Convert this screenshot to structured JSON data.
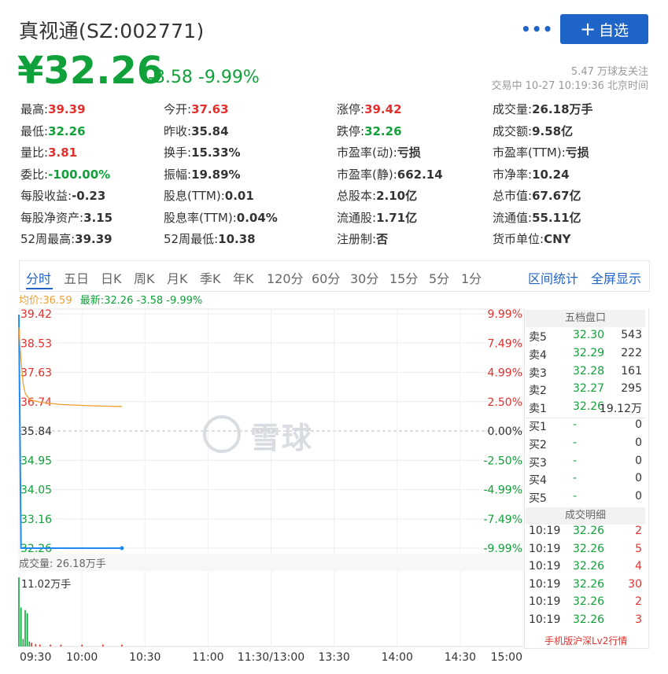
{
  "header": {
    "title": "真视通(SZ:002771)",
    "more_label": "•••",
    "add_button_label": "自选",
    "add_button_icon": "plus-icon",
    "price": "¥32.26",
    "change": "-3.58 -9.99%",
    "followers": "5.47 万球友关注",
    "trade_status": "交易中 10-27 10:19:36 北京时间"
  },
  "stats": {
    "rows": [
      [
        {
          "label": "最高:",
          "value": "39.39",
          "color": "red"
        },
        {
          "label": "今开:",
          "value": "37.63",
          "color": "red"
        },
        {
          "label": "涨停:",
          "value": "39.42",
          "color": "red"
        },
        {
          "label": "成交量:",
          "value": "26.18万手",
          "color": ""
        }
      ],
      [
        {
          "label": "最低:",
          "value": "32.26",
          "color": "green"
        },
        {
          "label": "昨收:",
          "value": "35.84",
          "color": ""
        },
        {
          "label": "跌停:",
          "value": "32.26",
          "color": "green"
        },
        {
          "label": "成交额:",
          "value": "9.58亿",
          "color": ""
        }
      ],
      [
        {
          "label": "量比:",
          "value": "3.81",
          "color": "red"
        },
        {
          "label": "换手:",
          "value": "15.33%",
          "color": ""
        },
        {
          "label": "市盈率(动):",
          "value": "亏损",
          "color": ""
        },
        {
          "label": "市盈率(TTM):",
          "value": "亏损",
          "color": ""
        }
      ],
      [
        {
          "label": "委比:",
          "value": "-100.00%",
          "color": "green"
        },
        {
          "label": "振幅:",
          "value": "19.89%",
          "color": ""
        },
        {
          "label": "市盈率(静):",
          "value": "662.14",
          "color": ""
        },
        {
          "label": "市净率:",
          "value": "10.24",
          "color": ""
        }
      ],
      [
        {
          "label": "每股收益:",
          "value": "-0.23",
          "color": ""
        },
        {
          "label": "股息(TTM):",
          "value": "0.01",
          "color": ""
        },
        {
          "label": "总股本:",
          "value": "2.10亿",
          "color": ""
        },
        {
          "label": "总市值:",
          "value": "67.67亿",
          "color": ""
        }
      ],
      [
        {
          "label": "每股净资产:",
          "value": "3.15",
          "color": ""
        },
        {
          "label": "股息率(TTM):",
          "value": "0.04%",
          "color": ""
        },
        {
          "label": "流通股:",
          "value": "1.71亿",
          "color": ""
        },
        {
          "label": "流通值:",
          "value": "55.11亿",
          "color": ""
        }
      ],
      [
        {
          "label": "52周最高:",
          "value": "39.39",
          "color": ""
        },
        {
          "label": "52周最低:",
          "value": "10.38",
          "color": ""
        },
        {
          "label": "注册制:",
          "value": "否",
          "color": ""
        },
        {
          "label": "货币单位:",
          "value": "CNY",
          "color": ""
        }
      ]
    ]
  },
  "tabs": {
    "items": [
      "分时",
      "五日",
      "日K",
      "周K",
      "月K",
      "季K",
      "年K",
      "120分",
      "60分",
      "30分",
      "15分",
      "5分",
      "1分"
    ],
    "active": "分时",
    "right": [
      "区间统计",
      "全屏显示"
    ]
  },
  "chart_info": {
    "avg_label": "均价:36.59",
    "latest_label": "最新:32.26 -3.58 -9.99%",
    "volume_label": "成交量: 26.18万手",
    "volume_max_label": "11.02万手",
    "watermark": "雪球"
  },
  "chart_data": {
    "type": "line",
    "title": "",
    "ylim": [
      32.26,
      39.42
    ],
    "y_ticks_left": [
      "39.42",
      "38.53",
      "37.63",
      "36.74",
      "35.84",
      "34.95",
      "34.05",
      "33.16",
      "32.26"
    ],
    "y_ticks_right": [
      "9.99%",
      "7.49%",
      "4.99%",
      "2.50%",
      "0.00%",
      "-2.50%",
      "-4.99%",
      "-7.49%",
      "-9.99%"
    ],
    "x_ticks": [
      "09:30",
      "10:00",
      "10:30",
      "11:00",
      "11:30/13:00",
      "13:30",
      "14:00",
      "14:30",
      "15:00"
    ],
    "series": [
      {
        "name": "最新",
        "color": "#1f8bf2",
        "x": [
          "09:30",
          "09:31",
          "09:32",
          "10:19"
        ],
        "values": [
          39.39,
          32.26,
          32.26,
          32.26
        ]
      },
      {
        "name": "均价",
        "color": "#f0a032",
        "x": [
          "09:30",
          "09:31",
          "09:32",
          "09:33",
          "09:35",
          "09:40",
          "09:45",
          "09:50",
          "10:00",
          "10:10",
          "10:19"
        ],
        "values": [
          39.0,
          38.0,
          37.3,
          37.0,
          36.8,
          36.72,
          36.68,
          36.65,
          36.62,
          36.6,
          36.59
        ]
      }
    ],
    "volume": {
      "unit": "万手",
      "max": 11.02,
      "x": [
        "09:30",
        "09:31",
        "09:32",
        "09:33",
        "09:34",
        "09:35",
        "09:36",
        "09:38",
        "09:40",
        "09:45",
        "09:50",
        "10:00",
        "10:10",
        "10:19"
      ],
      "values": [
        11.02,
        6.2,
        1.2,
        5.8,
        5.3,
        0.8,
        0.6,
        0.4,
        0.3,
        0.3,
        0.3,
        0.3,
        0.3,
        0.3
      ]
    }
  },
  "orderbook": {
    "title": "五档盘口",
    "asks": [
      {
        "label": "卖5",
        "price": "32.30",
        "vol": "543"
      },
      {
        "label": "卖4",
        "price": "32.29",
        "vol": "222"
      },
      {
        "label": "卖3",
        "price": "32.28",
        "vol": "161"
      },
      {
        "label": "卖2",
        "price": "32.27",
        "vol": "295"
      },
      {
        "label": "卖1",
        "price": "32.26",
        "vol": "19.12万"
      }
    ],
    "bids": [
      {
        "label": "买1",
        "price": "-",
        "vol": "0"
      },
      {
        "label": "买2",
        "price": "-",
        "vol": "0"
      },
      {
        "label": "买3",
        "price": "-",
        "vol": "0"
      },
      {
        "label": "买4",
        "price": "-",
        "vol": "0"
      },
      {
        "label": "买5",
        "price": "-",
        "vol": "0"
      }
    ],
    "detail_title": "成交明细",
    "trades": [
      {
        "time": "10:19",
        "price": "32.26",
        "vol": "2"
      },
      {
        "time": "10:19",
        "price": "32.26",
        "vol": "5"
      },
      {
        "time": "10:19",
        "price": "32.26",
        "vol": "4"
      },
      {
        "time": "10:19",
        "price": "32.26",
        "vol": "30"
      },
      {
        "time": "10:19",
        "price": "32.26",
        "vol": "2"
      },
      {
        "time": "10:19",
        "price": "32.26",
        "vol": "3"
      }
    ],
    "lv2_link": "手机版沪深Lv2行情"
  },
  "colors": {
    "red": "#e2312d",
    "green": "#11a13a",
    "blue": "#1f65c8",
    "avg": "#f0a032",
    "price": "#1f8bf2"
  }
}
